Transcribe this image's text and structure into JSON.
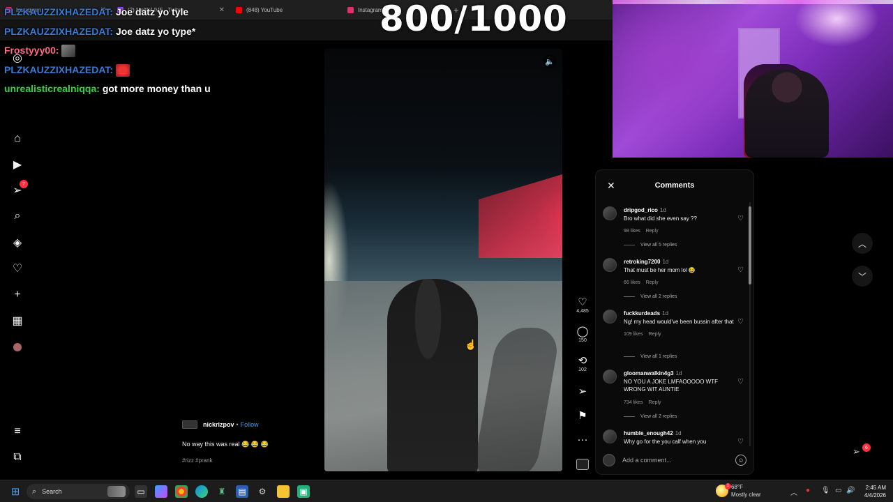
{
  "browser": {
    "tabs": [
      {
        "label": "Instagram",
        "color": "#e1306c"
      },
      {
        "label": "(2) MeltIsLIVE - Twitch",
        "color": "#9146ff"
      },
      {
        "label": "(848) YouTube",
        "color": "#ff0000"
      },
      {
        "label": "Instagram",
        "color": "#e1306c"
      }
    ]
  },
  "chat": {
    "messages": [
      {
        "user": "PLZKAUZZIXHAZEDAT:",
        "text": "Joe datz yo tyle",
        "color": "#3a7bd5"
      },
      {
        "user": "PLZKAUZZIXHAZEDAT:",
        "text": "Joe datz yo type*",
        "color": "#3a7bd5"
      },
      {
        "user": "Frostyyy00:",
        "text": "",
        "color": "#ff6a8a"
      },
      {
        "user": "PLZKAUZZIXHAZEDAT:",
        "text": "",
        "color": "#3a7bd5"
      },
      {
        "user": "unrealisticrealniqqa:",
        "text": "got more money than u",
        "color": "#35d33d"
      }
    ]
  },
  "counter": "800/1000",
  "post": {
    "author": "nickrizpov",
    "follow": "Follow",
    "caption": "No way this was real 😂 😂 😂",
    "tags": "#rizz #prank",
    "likes": "4,485",
    "comments": "150",
    "reposts": "102"
  },
  "comments_panel": {
    "title": "Comments",
    "placeholder": "Add a comment...",
    "items": [
      {
        "user": "dripgod_rico",
        "time": "1d",
        "text": "Bro what did she even say ??",
        "likes": "98 likes",
        "reply": "Reply",
        "view_all": "View all 5 replies"
      },
      {
        "user": "retroking7200",
        "time": "1d",
        "text": "That must be her mom lol 😂",
        "likes": "66 likes",
        "reply": "Reply",
        "view_all": "View all 2 replies"
      },
      {
        "user": "fuckkurdeads",
        "time": "1d",
        "text": "Ng! my head would've been bussin after that",
        "likes": "109 likes",
        "reply": "Reply",
        "view_all": "View all 1 replies"
      },
      {
        "user": "gloomanwalkin4g3",
        "time": "1d",
        "text": "NO YOU A JOKE LMFAOOOOO WTF WRONG WIT AUNTIE",
        "likes": "734 likes",
        "reply": "Reply",
        "view_all": "View all 2 replies"
      },
      {
        "user": "humble_enough42",
        "time": "1d",
        "text": "Why go for the you calf when you",
        "likes": "",
        "reply": "",
        "view_all": ""
      }
    ]
  },
  "nav": {
    "notifications_badge": "7",
    "activity_badge": "6"
  },
  "taskbar": {
    "search": "Search",
    "temperature": "68°F",
    "weather": "Mostly clear",
    "weather_badge": "1",
    "time": "2:45 AM",
    "date": "4/4/2026"
  }
}
